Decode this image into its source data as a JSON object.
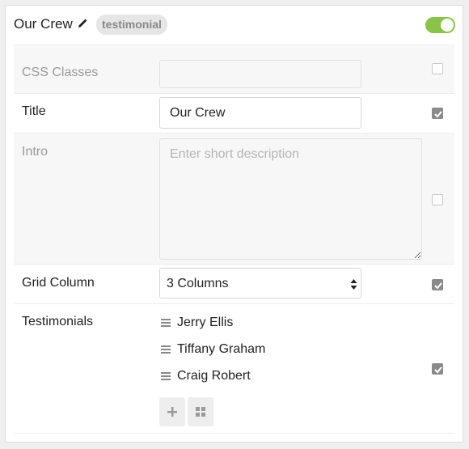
{
  "header": {
    "title": "Our Crew",
    "tag": "testimonial",
    "enabled": true
  },
  "fields": {
    "css_classes": {
      "label": "CSS Classes",
      "value": "",
      "checked": false
    },
    "title": {
      "label": "Title",
      "value": "Our Crew",
      "checked": true
    },
    "intro": {
      "label": "Intro",
      "placeholder": "Enter short description",
      "value": "",
      "checked": false
    },
    "grid_column": {
      "label": "Grid Column",
      "value": "3 Columns",
      "checked": true
    },
    "testimonials": {
      "label": "Testimonials",
      "items": [
        "Jerry Ellis",
        "Tiffany Graham",
        "Craig Robert"
      ],
      "checked": true
    }
  },
  "icons": {
    "edit": "pencil-icon",
    "drag": "drag-handle-icon",
    "add": "plus-icon",
    "grid": "grid-icon"
  },
  "colors": {
    "toggle_on": "#8bc34a",
    "checked": "#8a8a8a",
    "disabled_row": "#f7f7f7"
  }
}
